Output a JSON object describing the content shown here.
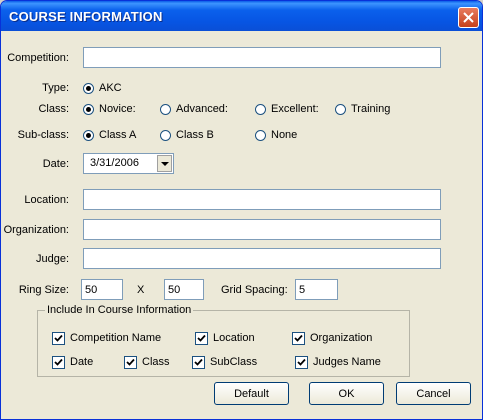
{
  "window": {
    "title": "COURSE INFORMATION"
  },
  "fields": {
    "competition": {
      "label": "Competition:",
      "value": ""
    },
    "type": {
      "label": "Type:",
      "options": [
        "AKC"
      ],
      "selected": "AKC"
    },
    "class": {
      "label": "Class:",
      "options": [
        "Novice:",
        "Advanced:",
        "Excellent:",
        "Training"
      ],
      "selected": "Novice:"
    },
    "subclass": {
      "label": "Sub-class:",
      "options": [
        "Class A",
        "Class B",
        "None"
      ],
      "selected": "Class A"
    },
    "date": {
      "label": "Date:",
      "value": "3/31/2006"
    },
    "location": {
      "label": "Location:",
      "value": ""
    },
    "organization": {
      "label": "Organization:",
      "value": ""
    },
    "judge": {
      "label": "Judge:",
      "value": ""
    },
    "ring_size": {
      "label": "Ring Size:",
      "width": "50",
      "separator": "X",
      "height": "50"
    },
    "grid_spacing": {
      "label": "Grid Spacing:",
      "value": "5"
    }
  },
  "include_group": {
    "title": "Include In Course Information",
    "items": [
      {
        "label": "Competition Name",
        "checked": true
      },
      {
        "label": "Location",
        "checked": true
      },
      {
        "label": "Organization",
        "checked": true
      },
      {
        "label": "Date",
        "checked": true
      },
      {
        "label": "Class",
        "checked": true
      },
      {
        "label": "SubClass",
        "checked": true
      },
      {
        "label": "Judges Name",
        "checked": true
      }
    ]
  },
  "buttons": {
    "default": "Default",
    "ok": "OK",
    "cancel": "Cancel"
  },
  "icons": {
    "close": "close-icon",
    "dropdown": "chevron-down-icon",
    "check": "checkmark-icon"
  }
}
